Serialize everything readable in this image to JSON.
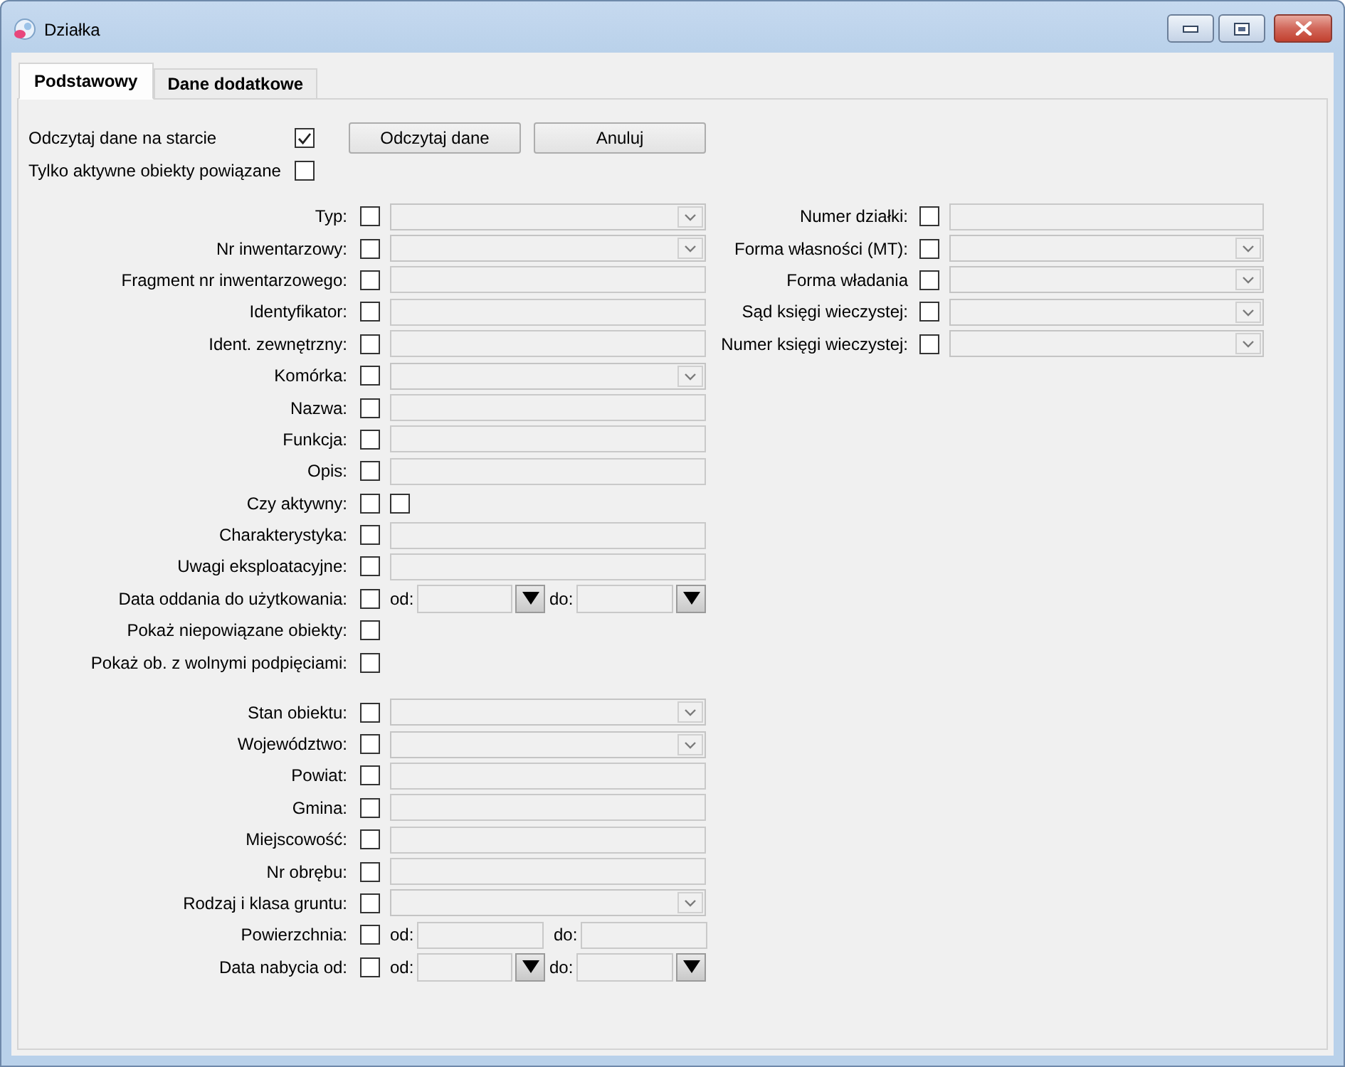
{
  "window": {
    "title": "Działka"
  },
  "tabs": [
    {
      "label": "Podstawowy",
      "selected": true
    },
    {
      "label": "Dane dodatkowe",
      "selected": false
    }
  ],
  "options": [
    {
      "label": "Odczytaj dane na starcie",
      "checked": true
    },
    {
      "label": "Tylko aktywne obiekty powiązane",
      "checked": false
    }
  ],
  "buttons": [
    {
      "label": "Odczytaj dane"
    },
    {
      "label": "Anuluj"
    }
  ],
  "left_sections": [
    {
      "fields": [
        {
          "label": "Typ:",
          "checked": false,
          "kind": "combo"
        },
        {
          "label": "Nr inwentarzowy:",
          "checked": false,
          "kind": "combo"
        },
        {
          "label": "Fragment nr inwentarzowego:",
          "checked": false,
          "kind": "text"
        },
        {
          "label": "Identyfikator:",
          "checked": false,
          "kind": "text"
        },
        {
          "label": "Ident. zewnętrzny:",
          "checked": false,
          "kind": "text"
        },
        {
          "label": "Komórka:",
          "checked": false,
          "kind": "combo"
        },
        {
          "label": "Nazwa:",
          "checked": false,
          "kind": "text"
        },
        {
          "label": "Funkcja:",
          "checked": false,
          "kind": "text"
        },
        {
          "label": "Opis:",
          "checked": false,
          "kind": "text"
        },
        {
          "label": "Czy aktywny:",
          "checked": false,
          "kind": "toggle",
          "value_checked": false
        },
        {
          "label": "Charakterystyka:",
          "checked": false,
          "kind": "text"
        },
        {
          "label": "Uwagi eksploatacyjne:",
          "checked": false,
          "kind": "text"
        },
        {
          "label": "Data oddania do użytkowania:",
          "checked": false,
          "kind": "daterange",
          "from_label": "od:",
          "to_label": "do:"
        },
        {
          "label": "Pokaż niepowiązane obiekty:",
          "checked": false,
          "kind": "bare"
        },
        {
          "label": "Pokaż ob. z wolnymi podpięciami:",
          "checked": false,
          "kind": "bare"
        }
      ]
    },
    {
      "fields": [
        {
          "label": "Stan obiektu:",
          "checked": false,
          "kind": "combo"
        },
        {
          "label": "Województwo:",
          "checked": false,
          "kind": "combo"
        },
        {
          "label": "Powiat:",
          "checked": false,
          "kind": "text"
        },
        {
          "label": "Gmina:",
          "checked": false,
          "kind": "text"
        },
        {
          "label": "Miejscowość:",
          "checked": false,
          "kind": "text"
        },
        {
          "label": "Nr obrębu:",
          "checked": false,
          "kind": "text"
        },
        {
          "label": "Rodzaj i klasa gruntu:",
          "checked": false,
          "kind": "combo"
        },
        {
          "label": "Powierzchnia:",
          "checked": false,
          "kind": "range",
          "from_label": "od:",
          "to_label": "do:"
        },
        {
          "label": "Data nabycia od:",
          "checked": false,
          "kind": "daterange",
          "from_label": "od:",
          "to_label": "do:"
        }
      ]
    }
  ],
  "right_fields": [
    {
      "label": "Numer działki:",
      "checked": false,
      "kind": "text"
    },
    {
      "label": "Forma własności (MT):",
      "checked": false,
      "kind": "combo"
    },
    {
      "label": "Forma władania",
      "checked": false,
      "kind": "combo"
    },
    {
      "label": "Sąd księgi wieczystej:",
      "checked": false,
      "kind": "combo"
    },
    {
      "label": "Numer księgi wieczystej:",
      "checked": false,
      "kind": "combo"
    }
  ]
}
